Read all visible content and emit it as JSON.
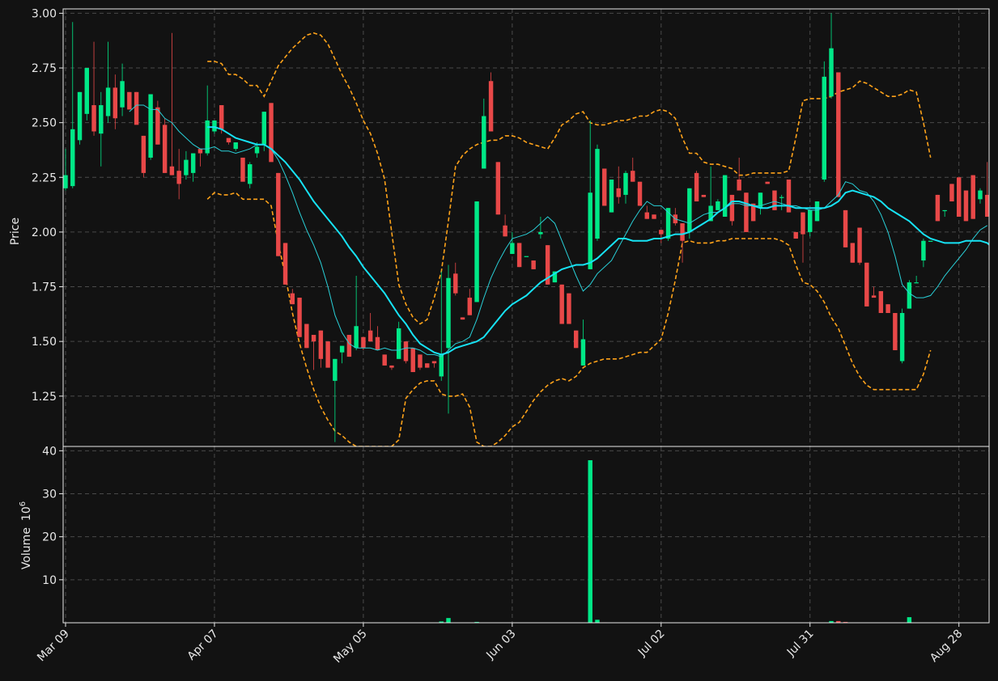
{
  "chart_data": {
    "type": "candlestick",
    "ylabel_price": "Price",
    "ylabel_volume": "Volume",
    "volume_exponent_label": "10",
    "volume_exponent_power": "6",
    "price_ylim": [
      1.02,
      3.02
    ],
    "price_yticks": [
      "1.25",
      "1.50",
      "1.75",
      "2.00",
      "2.25",
      "2.50",
      "2.75",
      "3.00"
    ],
    "price_ytick_values": [
      1.25,
      1.5,
      1.75,
      2.0,
      2.25,
      2.5,
      2.75,
      3.0
    ],
    "volume_ylim": [
      0,
      41
    ],
    "volume_yticks": [
      "10",
      "20",
      "30",
      "40"
    ],
    "volume_ytick_values": [
      10,
      20,
      30,
      40
    ],
    "xticks": [
      {
        "label": "Mar 09",
        "index": 0
      },
      {
        "label": "Apr 07",
        "index": 21
      },
      {
        "label": "May 05",
        "index": 42
      },
      {
        "label": "Jun 03",
        "index": 63
      },
      {
        "label": "Jul 02",
        "index": 84
      },
      {
        "label": "Jul 31",
        "index": 105
      },
      {
        "label": "Aug 28",
        "index": 126
      }
    ],
    "colors": {
      "up": "#00e887",
      "down": "#e84848",
      "ma_short": "#29d0d8",
      "ma_long": "#17e3f5",
      "bollinger": "#ffa31a",
      "grid": "#4a4a4a",
      "axes": "#e8e8e8",
      "background": "#121212"
    },
    "grid": true,
    "candles": [
      [
        2.2,
        2.38,
        2.19,
        2.26
      ],
      [
        2.21,
        2.96,
        2.2,
        2.47
      ],
      [
        2.42,
        2.64,
        2.4,
        2.64
      ],
      [
        2.54,
        2.75,
        2.51,
        2.75
      ],
      [
        2.58,
        2.87,
        2.44,
        2.46
      ],
      [
        2.45,
        2.64,
        2.3,
        2.58
      ],
      [
        2.53,
        2.87,
        2.5,
        2.66
      ],
      [
        2.66,
        2.72,
        2.47,
        2.52
      ],
      [
        2.57,
        2.77,
        2.53,
        2.69
      ],
      [
        2.64,
        2.64,
        2.56,
        2.56
      ],
      [
        2.64,
        2.64,
        2.51,
        2.49
      ],
      [
        2.44,
        2.44,
        2.25,
        2.27
      ],
      [
        2.34,
        2.63,
        2.33,
        2.63
      ],
      [
        2.57,
        2.6,
        2.4,
        2.4
      ],
      [
        2.49,
        2.52,
        2.27,
        2.27
      ],
      [
        2.3,
        2.91,
        2.26,
        2.26
      ],
      [
        2.28,
        2.38,
        2.15,
        2.22
      ],
      [
        2.26,
        2.37,
        2.24,
        2.33
      ],
      [
        2.27,
        2.36,
        2.23,
        2.36
      ],
      [
        2.38,
        2.38,
        2.3,
        2.36
      ],
      [
        2.36,
        2.67,
        2.35,
        2.51
      ],
      [
        2.46,
        2.51,
        2.45,
        2.51
      ],
      [
        2.58,
        2.58,
        2.45,
        2.47
      ],
      [
        2.43,
        2.43,
        2.4,
        2.41
      ],
      [
        2.38,
        2.41,
        2.37,
        2.41
      ],
      [
        2.34,
        2.34,
        2.25,
        2.23
      ],
      [
        2.22,
        2.32,
        2.2,
        2.31
      ],
      [
        2.36,
        2.41,
        2.34,
        2.39
      ],
      [
        2.4,
        2.55,
        2.37,
        2.55
      ],
      [
        2.59,
        2.59,
        2.33,
        2.32
      ],
      [
        2.27,
        2.27,
        1.89,
        1.89
      ],
      [
        1.95,
        1.95,
        1.76,
        1.76
      ],
      [
        1.72,
        1.74,
        1.67,
        1.67
      ],
      [
        1.7,
        1.7,
        1.52,
        1.52
      ],
      [
        1.58,
        1.58,
        1.47,
        1.47
      ],
      [
        1.53,
        1.53,
        1.37,
        1.5
      ],
      [
        1.55,
        1.55,
        1.38,
        1.42
      ],
      [
        1.5,
        1.5,
        1.38,
        1.38
      ],
      [
        1.32,
        1.42,
        1.04,
        1.42
      ],
      [
        1.45,
        1.48,
        1.4,
        1.48
      ],
      [
        1.53,
        1.53,
        1.43,
        1.43
      ],
      [
        1.47,
        1.8,
        1.46,
        1.57
      ],
      [
        1.52,
        1.52,
        1.46,
        1.47
      ],
      [
        1.55,
        1.63,
        1.5,
        1.5
      ],
      [
        1.52,
        1.57,
        1.46,
        1.46
      ],
      [
        1.44,
        1.44,
        1.39,
        1.39
      ],
      [
        1.39,
        1.39,
        1.37,
        1.38
      ],
      [
        1.42,
        1.59,
        1.42,
        1.56
      ],
      [
        1.5,
        1.5,
        1.4,
        1.41
      ],
      [
        1.47,
        1.47,
        1.36,
        1.36
      ],
      [
        1.44,
        1.44,
        1.37,
        1.38
      ],
      [
        1.4,
        1.4,
        1.38,
        1.38
      ],
      [
        1.41,
        1.41,
        1.38,
        1.4
      ],
      [
        1.34,
        1.82,
        1.32,
        1.44
      ],
      [
        1.47,
        1.85,
        1.17,
        1.79
      ],
      [
        1.81,
        1.86,
        1.71,
        1.72
      ],
      [
        1.61,
        1.61,
        1.6,
        1.6
      ],
      [
        1.7,
        1.74,
        1.62,
        1.62
      ],
      [
        1.68,
        2.14,
        1.68,
        2.14
      ],
      [
        2.29,
        2.61,
        2.29,
        2.53
      ],
      [
        2.69,
        2.73,
        2.46,
        2.46
      ],
      [
        2.32,
        2.32,
        2.08,
        2.08
      ],
      [
        2.03,
        2.08,
        1.98,
        1.98
      ],
      [
        1.9,
        2.0,
        1.9,
        1.95
      ],
      [
        1.95,
        1.95,
        1.84,
        1.84
      ],
      [
        1.89,
        1.89,
        1.89,
        1.89
      ],
      [
        1.87,
        1.87,
        1.83,
        1.83
      ],
      [
        1.99,
        2.07,
        1.97,
        2.0
      ],
      [
        1.94,
        1.94,
        1.76,
        1.76
      ],
      [
        1.77,
        1.82,
        1.77,
        1.82
      ],
      [
        1.76,
        1.76,
        1.58,
        1.58
      ],
      [
        1.72,
        1.72,
        1.58,
        1.58
      ],
      [
        1.55,
        1.55,
        1.47,
        1.47
      ],
      [
        1.39,
        1.6,
        1.39,
        1.51
      ],
      [
        1.83,
        2.51,
        1.83,
        2.18
      ],
      [
        1.97,
        2.4,
        1.96,
        2.38
      ],
      [
        2.29,
        2.29,
        2.12,
        2.12
      ],
      [
        2.09,
        2.24,
        2.09,
        2.24
      ],
      [
        2.2,
        2.3,
        2.13,
        2.16
      ],
      [
        2.17,
        2.28,
        2.13,
        2.27
      ],
      [
        2.28,
        2.34,
        2.23,
        2.23
      ],
      [
        2.23,
        2.23,
        2.12,
        2.12
      ],
      [
        2.09,
        2.12,
        2.06,
        2.06
      ],
      [
        2.08,
        2.08,
        2.06,
        2.06
      ],
      [
        2.01,
        2.01,
        1.95,
        1.99
      ],
      [
        1.97,
        2.11,
        1.96,
        2.11
      ],
      [
        2.08,
        2.11,
        2.03,
        2.04
      ],
      [
        2.04,
        2.04,
        1.86,
        1.96
      ],
      [
        2.0,
        2.2,
        1.97,
        2.2
      ],
      [
        2.27,
        2.28,
        2.14,
        2.14
      ],
      [
        2.17,
        2.17,
        2.16,
        2.16
      ],
      [
        2.05,
        2.3,
        2.05,
        2.12
      ],
      [
        2.1,
        2.15,
        2.1,
        2.14
      ],
      [
        2.07,
        2.26,
        2.07,
        2.26
      ],
      [
        2.17,
        2.17,
        2.03,
        2.05
      ],
      [
        2.24,
        2.34,
        2.19,
        2.19
      ],
      [
        2.18,
        2.18,
        2.0,
        2.0
      ],
      [
        2.13,
        2.13,
        2.05,
        2.05
      ],
      [
        2.11,
        2.18,
        2.08,
        2.18
      ],
      [
        2.23,
        2.23,
        2.22,
        2.22
      ],
      [
        2.19,
        2.19,
        2.1,
        2.1
      ],
      [
        2.16,
        2.17,
        2.1,
        2.16
      ],
      [
        2.24,
        2.24,
        2.09,
        2.09
      ],
      [
        2.0,
        2.0,
        1.97,
        1.97
      ],
      [
        2.09,
        2.09,
        1.86,
        1.99
      ],
      [
        2.0,
        2.1,
        1.98,
        2.1
      ],
      [
        2.05,
        2.14,
        2.05,
        2.14
      ],
      [
        2.24,
        2.78,
        2.23,
        2.71
      ],
      [
        2.62,
        3.0,
        2.61,
        2.84
      ],
      [
        2.73,
        2.73,
        2.16,
        2.16
      ],
      [
        2.1,
        2.1,
        1.93,
        1.93
      ],
      [
        1.95,
        1.95,
        1.86,
        1.86
      ],
      [
        2.02,
        2.02,
        1.85,
        1.86
      ],
      [
        1.86,
        1.86,
        1.66,
        1.66
      ],
      [
        1.71,
        1.75,
        1.7,
        1.7
      ],
      [
        1.73,
        1.73,
        1.63,
        1.63
      ],
      [
        1.67,
        1.67,
        1.63,
        1.63
      ],
      [
        1.63,
        1.63,
        1.46,
        1.46
      ],
      [
        1.41,
        1.65,
        1.4,
        1.63
      ],
      [
        1.65,
        1.78,
        1.65,
        1.77
      ],
      [
        1.77,
        1.8,
        1.77,
        1.77
      ],
      [
        1.87,
        1.97,
        1.84,
        1.96
      ],
      [
        1.96,
        1.96,
        1.96,
        1.96
      ],
      [
        2.17,
        2.17,
        2.05,
        2.05
      ],
      [
        2.1,
        2.1,
        2.07,
        2.1
      ],
      [
        2.22,
        2.22,
        2.14,
        2.14
      ],
      [
        2.25,
        2.25,
        2.07,
        2.07
      ],
      [
        2.19,
        2.19,
        2.05,
        2.05
      ],
      [
        2.26,
        2.26,
        2.06,
        2.06
      ],
      [
        2.15,
        2.2,
        2.13,
        2.19
      ],
      [
        2.17,
        2.32,
        2.07,
        2.07
      ]
    ],
    "volume": [
      0,
      0,
      0,
      0,
      0,
      0,
      0,
      0,
      0,
      0,
      0,
      0,
      0,
      0,
      0,
      0,
      0,
      0,
      0,
      0,
      0,
      0,
      0,
      0,
      0,
      0,
      0,
      0,
      0,
      0,
      0,
      0,
      0,
      0,
      0,
      0,
      0,
      0,
      0,
      0,
      0,
      0,
      0,
      0,
      0,
      0,
      0,
      0,
      0,
      0,
      0,
      0,
      0,
      0.3,
      1.1,
      0,
      0,
      0,
      0.2,
      0,
      0,
      0,
      0,
      0,
      0,
      0,
      0,
      0,
      0,
      0,
      0,
      0,
      0,
      0,
      37.8,
      0.7,
      0.1,
      0,
      0,
      0,
      0,
      0,
      0,
      0,
      0,
      0,
      0,
      0,
      0,
      0,
      0,
      0,
      0,
      0,
      0,
      0,
      0,
      0,
      0,
      0,
      0,
      0,
      0,
      0,
      0,
      0,
      0,
      0,
      0.4,
      0.4,
      0.2,
      0,
      0,
      0,
      0,
      0,
      0,
      0,
      0,
      1.3,
      0,
      0,
      0,
      0,
      0,
      0,
      0,
      0,
      0,
      0,
      0
    ],
    "ma_long": [
      null,
      null,
      null,
      null,
      null,
      null,
      null,
      null,
      null,
      null,
      null,
      null,
      null,
      null,
      null,
      null,
      null,
      null,
      null,
      null,
      2.48,
      2.48,
      2.47,
      2.45,
      2.43,
      2.42,
      2.41,
      2.4,
      2.4,
      2.38,
      2.35,
      2.32,
      2.28,
      2.24,
      2.19,
      2.14,
      2.1,
      2.06,
      2.02,
      1.98,
      1.93,
      1.89,
      1.84,
      1.8,
      1.76,
      1.72,
      1.67,
      1.62,
      1.58,
      1.53,
      1.49,
      1.47,
      1.45,
      1.44,
      1.45,
      1.47,
      1.48,
      1.49,
      1.5,
      1.52,
      1.56,
      1.6,
      1.64,
      1.67,
      1.69,
      1.71,
      1.74,
      1.77,
      1.79,
      1.81,
      1.83,
      1.84,
      1.85,
      1.85,
      1.86,
      1.88,
      1.91,
      1.94,
      1.97,
      1.97,
      1.96,
      1.96,
      1.96,
      1.97,
      1.97,
      1.98,
      1.99,
      1.99,
      2.0,
      2.02,
      2.04,
      2.06,
      2.09,
      2.11,
      2.14,
      2.14,
      2.13,
      2.12,
      2.11,
      2.11,
      2.12,
      2.12,
      2.12,
      2.11,
      2.11,
      2.11,
      2.11,
      2.11,
      2.12,
      2.14,
      2.18,
      2.19,
      2.18,
      2.17,
      2.16,
      2.14,
      2.11,
      2.09,
      2.07,
      2.05,
      2.02,
      1.99,
      1.97,
      1.96,
      1.95,
      1.95,
      1.95,
      1.96,
      1.96,
      1.96,
      1.95,
      1.92,
      1.89
    ],
    "ma_short": [
      null,
      null,
      null,
      null,
      null,
      null,
      null,
      null,
      null,
      2.55,
      2.58,
      2.58,
      2.56,
      2.56,
      2.52,
      2.5,
      2.46,
      2.43,
      2.4,
      2.38,
      2.38,
      2.39,
      2.37,
      2.37,
      2.36,
      2.37,
      2.38,
      2.4,
      2.4,
      2.38,
      2.33,
      2.26,
      2.18,
      2.09,
      2.01,
      1.94,
      1.86,
      1.75,
      1.62,
      1.54,
      1.49,
      1.47,
      1.47,
      1.47,
      1.46,
      1.47,
      1.46,
      1.46,
      1.47,
      1.47,
      1.46,
      1.44,
      1.44,
      1.43,
      1.46,
      1.49,
      1.5,
      1.52,
      1.6,
      1.7,
      1.79,
      1.86,
      1.92,
      1.97,
      1.98,
      1.99,
      2.01,
      2.04,
      2.07,
      2.04,
      1.96,
      1.88,
      1.8,
      1.73,
      1.76,
      1.81,
      1.84,
      1.87,
      1.93,
      1.99,
      2.05,
      2.1,
      2.14,
      2.12,
      2.12,
      2.09,
      2.06,
      2.05,
      2.04,
      2.06,
      2.08,
      2.09,
      2.09,
      2.11,
      2.13,
      2.13,
      2.12,
      2.12,
      2.12,
      2.13,
      2.14,
      2.13,
      2.12,
      2.12,
      2.11,
      2.1,
      2.1,
      2.11,
      2.14,
      2.17,
      2.23,
      2.22,
      2.19,
      2.18,
      2.14,
      2.08,
      2.0,
      1.89,
      1.76,
      1.72,
      1.7,
      1.7,
      1.71,
      1.75,
      1.8,
      1.84,
      1.88,
      1.92,
      1.97,
      2.01,
      2.03
    ],
    "bb_upper": [
      null,
      null,
      null,
      null,
      null,
      null,
      null,
      null,
      null,
      null,
      null,
      null,
      null,
      null,
      null,
      null,
      null,
      null,
      null,
      null,
      2.78,
      2.78,
      2.77,
      2.72,
      2.72,
      2.7,
      2.67,
      2.67,
      2.62,
      2.69,
      2.76,
      2.8,
      2.84,
      2.87,
      2.9,
      2.91,
      2.9,
      2.86,
      2.79,
      2.72,
      2.66,
      2.59,
      2.51,
      2.45,
      2.36,
      2.24,
      2.0,
      1.76,
      1.67,
      1.61,
      1.58,
      1.6,
      1.7,
      1.82,
      2.05,
      2.3,
      2.35,
      2.38,
      2.4,
      2.41,
      2.42,
      2.42,
      2.44,
      2.44,
      2.43,
      2.41,
      2.4,
      2.39,
      2.38,
      2.43,
      2.49,
      2.51,
      2.54,
      2.55,
      2.5,
      2.49,
      2.49,
      2.5,
      2.51,
      2.51,
      2.52,
      2.53,
      2.53,
      2.55,
      2.56,
      2.55,
      2.52,
      2.43,
      2.36,
      2.36,
      2.32,
      2.31,
      2.31,
      2.3,
      2.29,
      2.26,
      2.26,
      2.27,
      2.27,
      2.27,
      2.27,
      2.27,
      2.28,
      2.43,
      2.6,
      2.61,
      2.61,
      2.61,
      2.62,
      2.64,
      2.65,
      2.66,
      2.69,
      2.68,
      2.66,
      2.64,
      2.62,
      2.62,
      2.63,
      2.65,
      2.64,
      2.5,
      2.34
    ],
    "bb_lower": [
      null,
      null,
      null,
      null,
      null,
      null,
      null,
      null,
      null,
      null,
      null,
      null,
      null,
      null,
      null,
      null,
      null,
      null,
      null,
      null,
      2.15,
      2.18,
      2.17,
      2.17,
      2.18,
      2.15,
      2.15,
      2.15,
      2.15,
      2.12,
      1.95,
      1.8,
      1.63,
      1.49,
      1.38,
      1.28,
      1.2,
      1.14,
      1.09,
      1.07,
      1.04,
      1.02,
      1.02,
      1.02,
      1.02,
      1.02,
      1.02,
      1.05,
      1.24,
      1.28,
      1.31,
      1.32,
      1.32,
      1.26,
      1.25,
      1.25,
      1.26,
      1.2,
      1.04,
      1.02,
      1.02,
      1.04,
      1.07,
      1.11,
      1.13,
      1.18,
      1.23,
      1.27,
      1.3,
      1.32,
      1.33,
      1.32,
      1.34,
      1.38,
      1.4,
      1.41,
      1.42,
      1.42,
      1.42,
      1.43,
      1.44,
      1.45,
      1.45,
      1.48,
      1.51,
      1.63,
      1.78,
      1.95,
      1.96,
      1.95,
      1.95,
      1.95,
      1.96,
      1.96,
      1.97,
      1.97,
      1.97,
      1.97,
      1.97,
      1.97,
      1.97,
      1.96,
      1.94,
      1.85,
      1.77,
      1.76,
      1.73,
      1.68,
      1.61,
      1.56,
      1.48,
      1.4,
      1.34,
      1.3,
      1.28,
      1.28,
      1.28,
      1.28,
      1.28,
      1.28,
      1.28,
      1.35,
      1.46
    ]
  }
}
